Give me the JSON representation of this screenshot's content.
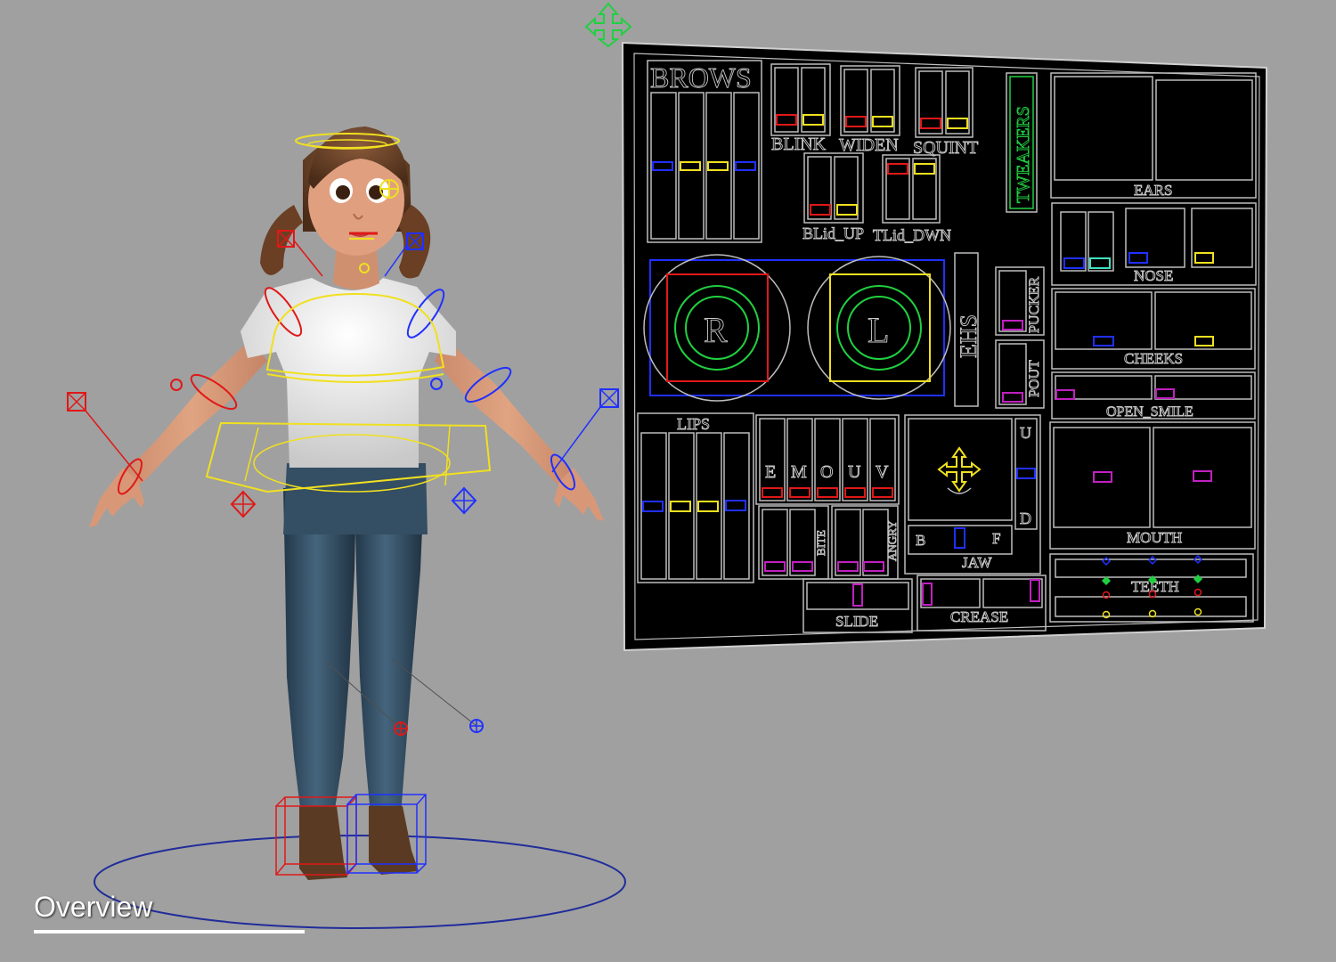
{
  "caption": "Overview",
  "picker": {
    "brows": "BROWS",
    "blink": "BLINK",
    "widen": "WIDEN",
    "squint": "SQUINT",
    "tweakers": "TWEAKERS",
    "ears": "EARS",
    "blid_up": "BLid_UP",
    "tlid_dwn": "TLid_DWN",
    "nose": "NOSE",
    "eye_r": "R",
    "eye_l": "L",
    "ehs": "EHS",
    "pucker": "PUCKER",
    "pout": "POUT",
    "cheeks": "CHEEKS",
    "open_smile": "OPEN_SMILE",
    "lips": "LIPS",
    "vowels": [
      "E",
      "M",
      "O",
      "U",
      "V"
    ],
    "bite": "BITE",
    "angry": "ANGRY",
    "jaw_u": "U",
    "jaw_d": "D",
    "jaw_b": "B",
    "jaw_f": "F",
    "jaw": "JAW",
    "mouth": "MOUTH",
    "teeth": "TEETH",
    "slide": "SLIDE",
    "crease": "CREASE"
  },
  "colors": {
    "background": "#a0a0a0",
    "panel": "#000000",
    "panel_lines": "#bdbdbd",
    "ctrl_red": "#e01818",
    "ctrl_yellow": "#f0e020",
    "ctrl_blue": "#2030ff",
    "ctrl_magenta": "#c020c0",
    "ctrl_green": "#20d040",
    "ctrl_cyan": "#40e0c0"
  }
}
